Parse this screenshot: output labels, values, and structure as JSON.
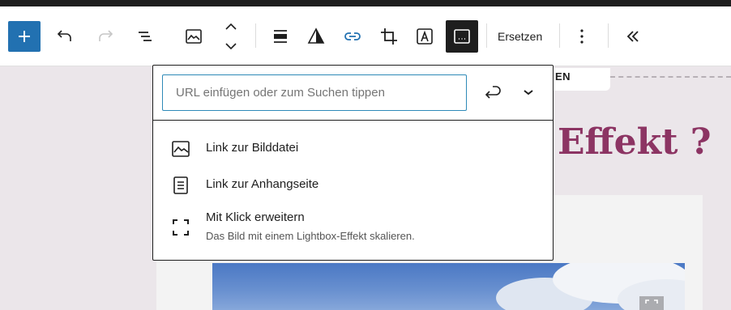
{
  "toolbar": {
    "buttons": [
      {
        "name": "add-block-button",
        "icon": "plus-icon"
      },
      {
        "name": "undo-button",
        "icon": "undo-icon"
      },
      {
        "name": "redo-button",
        "icon": "redo-icon"
      },
      {
        "name": "document-overview-button",
        "icon": "list-view-icon"
      },
      {
        "name": "block-type-button",
        "icon": "image-icon"
      },
      {
        "name": "move-updown-button",
        "icon": "chevron-up-down-icon"
      },
      {
        "name": "align-button",
        "icon": "align-center-icon"
      },
      {
        "name": "duotone-button",
        "icon": "duotone-icon"
      },
      {
        "name": "link-button",
        "icon": "link-icon"
      },
      {
        "name": "crop-button",
        "icon": "crop-icon"
      },
      {
        "name": "text-overlay-button",
        "icon": "text-overlay-icon"
      },
      {
        "name": "caption-button",
        "icon": "caption-icon"
      },
      {
        "name": "options-button",
        "icon": "more-vertical-icon"
      },
      {
        "name": "collapse-button",
        "icon": "chevron-double-left-icon"
      }
    ],
    "replace_label": "Ersetzen"
  },
  "canvas": {
    "tab_label": "EN",
    "heading_visible": "Effekt ?",
    "heading_color": "#8c3463"
  },
  "link_popover": {
    "url_input": {
      "placeholder": "URL einfügen oder zum Suchen tippen",
      "value": ""
    },
    "submit_icon": "enter-icon",
    "toggle_icon": "chevron-down-icon",
    "options": [
      {
        "label": "Link zur Bilddatei",
        "icon": "image-icon",
        "description": ""
      },
      {
        "label": "Link zur Anhangseite",
        "icon": "page-icon",
        "description": ""
      },
      {
        "label": "Mit Klick erweitern",
        "icon": "fullscreen-icon",
        "description": "Das Bild mit einem Lightbox-Effekt skalieren."
      }
    ]
  },
  "colors": {
    "accent": "#2271b1",
    "input_focus": "#2e8ab8",
    "link_active": "#2271b1",
    "dark": "#1e1e1e"
  }
}
